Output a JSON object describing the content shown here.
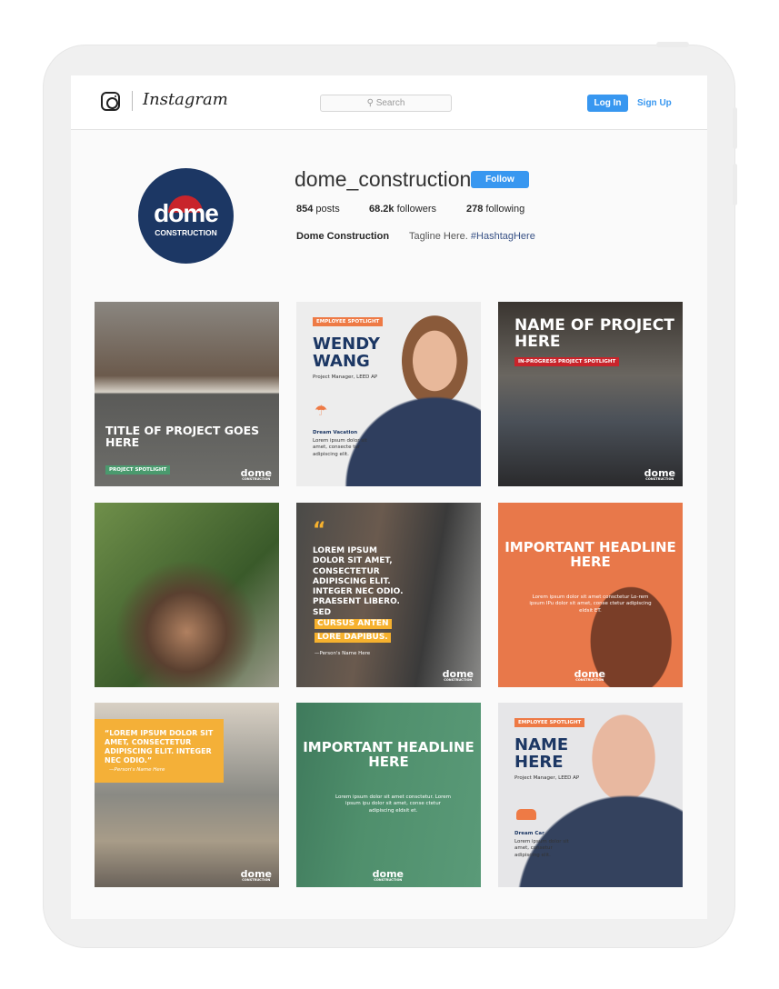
{
  "header": {
    "wordmark": "Instagram",
    "search_placeholder": "Search",
    "login": "Log In",
    "signup": "Sign Up"
  },
  "profile": {
    "avatar_word": "dome",
    "avatar_sub": "CONSTRUCTION",
    "username": "dome_construction",
    "follow": "Follow",
    "posts_count": "854",
    "posts_label": "posts",
    "followers_count": "68.2k",
    "followers_label": "followers",
    "following_count": "278",
    "following_label": "following",
    "name": "Dome Construction",
    "tagline": "Tagline Here.",
    "hashtag": "#HashtagHere",
    "accent": "#3897f0",
    "brand_navy": "#1c3764"
  },
  "posts": [
    {
      "title": "TITLE OF PROJECT GOES HERE",
      "tag": "PROJECT SPOTLIGHT"
    },
    {
      "tag": "EMPLOYEE SPOTLIGHT",
      "name": "WENDY WANG",
      "role": "Project Manager, LEED AP",
      "perk_icon": "umbrella-icon",
      "perk": "Dream Vacation",
      "perk_text": "Lorem ipsum dolor sit amet, consecte tur adipiscing elit."
    },
    {
      "title": "NAME OF PROJECT HERE",
      "tag": "IN-PROGRESS PROJECT SPOTLIGHT"
    },
    {},
    {
      "quote": "LOREM IPSUM DOLOR SIT AMET, CONSECTETUR ADIPISCING ELIT. INTEGER NEC ODIO. PRAESENT LIBERO. SED",
      "highlight1": "CURSUS ANTEN",
      "highlight2": "LORE DAPIBUS.",
      "attribution": "—Person's Name Here"
    },
    {
      "title": "IMPORTANT HEADLINE HERE",
      "body": "Lorem ipsum dolor sit amet consctetur Lo-rem ipsum IPu dolor sit amet, conse ctetur adipiscing eldsit ET."
    },
    {
      "quote": "“LOREM IPSUM DOLOR SIT AMET, CONSECTETUR ADIPISCING ELIT. INTEGER NEC ODIO.”",
      "attribution": "—Person's Name Here"
    },
    {
      "title": "IMPORTANT HEADLINE HERE",
      "body": "Lorem ipsum dolor sit amet consctetur. Lorem ipsum ipu dolor sit amet, conse ctetur adipiscing eldsit et."
    },
    {
      "tag": "EMPLOYEE SPOTLIGHT",
      "name": "NAME HERE",
      "role": "Project Manager, LEED AP",
      "perk_icon": "car-icon",
      "perk": "Dream Car",
      "perk_text": "Lorem ipsum dolor sit amet, consetur adipiscing elit."
    }
  ],
  "logo": {
    "word": "dome",
    "sub": "CONSTRUCTION"
  }
}
